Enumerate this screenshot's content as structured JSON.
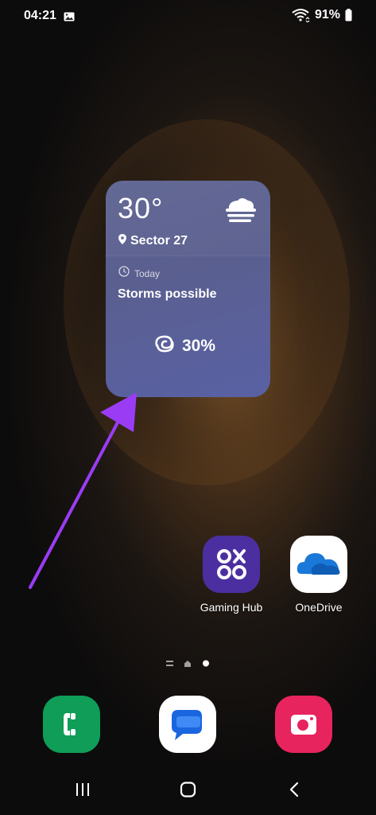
{
  "status_bar": {
    "time": "04:21",
    "battery_percent": "91%",
    "icons": [
      "gallery-icon",
      "wifi-icon",
      "battery-icon"
    ]
  },
  "weather_widget": {
    "temperature": "30°",
    "location": "Sector 27",
    "day_label": "Today",
    "forecast": "Storms possible",
    "precipitation": "30%",
    "icons": [
      "fog-icon",
      "location-pin-icon",
      "clock-icon",
      "precipitation-icon"
    ]
  },
  "apps": [
    {
      "label": "Gaming Hub",
      "icon": "gaming-hub-icon"
    },
    {
      "label": "OneDrive",
      "icon": "onedrive-icon"
    }
  ],
  "dock": [
    {
      "icon": "phone-icon",
      "color": "#0f9d58"
    },
    {
      "icon": "messages-icon",
      "color": "#ffffff"
    },
    {
      "icon": "camera-icon",
      "color": "#e8245e"
    }
  ],
  "nav_bar": {
    "buttons": [
      "recents-icon",
      "home-icon",
      "back-icon"
    ]
  },
  "page_indicator": {
    "pages": 2,
    "current": 2
  },
  "colors": {
    "widget_bg": "#5b62a0",
    "annotation_arrow": "#9b3cf5",
    "gaming_hub": "#4b2fa0",
    "onedrive_blue": "#1a78d8"
  }
}
